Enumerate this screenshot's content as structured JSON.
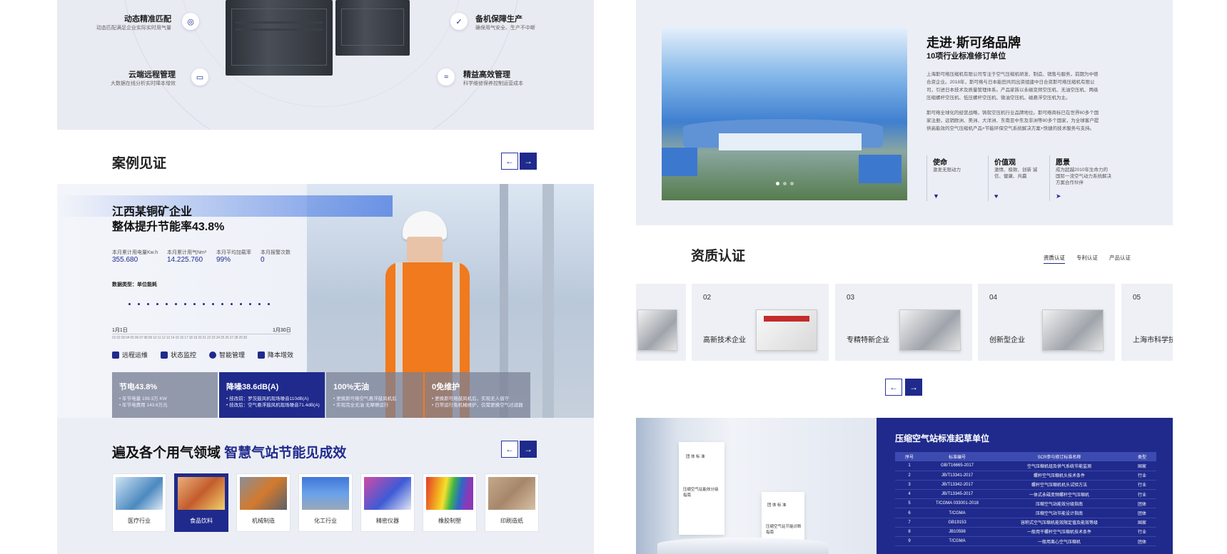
{
  "hero": {
    "features": [
      {
        "title": "动态精准匹配",
        "sub": "动态匹配满足企业实际实时用气量",
        "icon": "target-icon"
      },
      {
        "title": "云端远程管理",
        "sub": "大数据在线分析实时降本增效",
        "icon": "monitor-icon"
      },
      {
        "title": "备机保障生产",
        "sub": "确保用气安全、生产不中断",
        "icon": "shield-check-icon"
      },
      {
        "title": "精益高效管理",
        "sub": "科学维修保养控制运营成本",
        "icon": "chart-icon"
      }
    ]
  },
  "cases": {
    "title": "案例见证",
    "headline_1": "江西某铜矿企业",
    "headline_2": "整体提升节能率43.8%",
    "stats": [
      {
        "label": "本月累计用电量Kw.h",
        "value": "355.680"
      },
      {
        "label": "本月累计用气Nm³",
        "value": "14.225.760"
      },
      {
        "label": "本月平均加载率",
        "value": "99%"
      },
      {
        "label": "本月报警次数",
        "value": "0"
      }
    ],
    "data_type": "数据类型：单位能耗",
    "range_start": "1月1日",
    "range_end": "1月30日",
    "days": "01 02 03 04 05 06 07 08 09 10 11 12 13 14 15 16 17 18 19 20 21 22 23 24 25 26 27 28 29 30",
    "tags": [
      "远程运维",
      "状态监控",
      "智能管理",
      "降本增效"
    ],
    "cards": [
      {
        "title": "节电43.8%",
        "lines": [
          "• 年节电量 199.3万 KW",
          "• 年节电费用 143.6万元"
        ]
      },
      {
        "title": "降噪38.6dB(A)",
        "lines": [
          "• 技改前：罗茨鼓风机现场噪音110dB(A)",
          "• 技改后：空气悬浮鼓风机现场噪音71.4dB(A)"
        ]
      },
      {
        "title": "100%无油",
        "lines": [
          "• 更换斯可络空气悬浮鼓风机后",
          "• 实现完全无油 无摩擦运行"
        ]
      },
      {
        "title": "0免维护",
        "lines": [
          "• 更换斯可络鼓风机后，实现无人值守",
          "• 日常运行免机械维护，仅需更换空气过滤器"
        ]
      }
    ]
  },
  "industries": {
    "title_a": "遍及各个用气领域",
    "title_b": "智慧气站节能见成效",
    "items": [
      "医疗行业",
      "食品饮料",
      "机械制造",
      "化工行业",
      "精密仪器",
      "橡胶制塑",
      "印刷造纸"
    ]
  },
  "brand": {
    "title": "走进·斯可络品牌",
    "subtitle": "10项行业标准修订单位",
    "para1": "上海斯可络压缩机有限公司专注于空气压缩机研发、制造、销售与服务，前期为中德合资企业。2018年，斯可络与日本能田共同出资组建中日合资斯可络压缩机有限公司，引进日本技术及质量管理体系。产品家族以永磁变频空压机、无油空压机、两级压缩螺杆空压机、低压螺杆空压机、微油空压机、磁悬浮空压机为主。",
    "para2": "斯可络全球化的经营战略，铸就空压机行业品牌地位。斯可络商标已在世界60多个国家注册，远销欧洲、美洲、大洋洲、东南亚中东及非洲等80多个国家，为全球客户提供高能效的空气压缩机产品+节能环保空气系统解决方案+快捷的技术服务与支持。",
    "values": [
      {
        "title": "使命",
        "desc": "激发无限动力",
        "icon": "trophy-icon"
      },
      {
        "title": "价值观",
        "desc": "激情、极致、创新 诚信、健康、共赢",
        "icon": "heart-icon"
      },
      {
        "title": "愿景",
        "desc": "成为超越2010年生命力的国际一流空气动力系统解决方案合作伙伴",
        "icon": "send-icon"
      }
    ]
  },
  "certs": {
    "title": "资质认证",
    "tabs": [
      "资质认证",
      "专利认证",
      "产品认证"
    ],
    "items": [
      {
        "num": "02",
        "name": "高新技术企业",
        "style": "red"
      },
      {
        "num": "03",
        "name": "专精特新企业",
        "style": "silver"
      },
      {
        "num": "04",
        "name": "创新型企业",
        "style": "silver"
      },
      {
        "num": "05",
        "name": "上海市科学技",
        "style": "plain"
      }
    ]
  },
  "standards": {
    "title": "压缩空气站标准起草单位",
    "doc1_head": "团 体 标 准",
    "doc1_title": "压缩空气站能效分级指南",
    "doc2_head": "团 体 标 准",
    "doc2_title": "压缩空气站节能诊断指南",
    "headers": [
      "序号",
      "标准编号",
      "SCR参与修订标准名称",
      "类型"
    ],
    "rows": [
      [
        "1",
        "GB/T16665-2017",
        "空气压缩机组及供气系统节能监测",
        "国家"
      ],
      [
        "2",
        "JB/T13341-2017",
        "螺杆空气压缩机头技术条件",
        "行业"
      ],
      [
        "3",
        "JB/T13342-2017",
        "螺杆空气压缩机机头试验方法",
        "行业"
      ],
      [
        "4",
        "JB/T13345-2017",
        "一体式永磁变频螺杆空气压缩机",
        "行业"
      ],
      [
        "5",
        "T/CGMA 033001-2018",
        "压缩空气站能效分级指南",
        "团体"
      ],
      [
        "6",
        "T/CGMA",
        "压缩空气站节能设计指南",
        "团体"
      ],
      [
        "7",
        "GB19153",
        "容积式空气压缩机能效限定值及能效等级",
        "国家"
      ],
      [
        "8",
        "JB10598",
        "一般用干螺杆空气压缩机技术条件",
        "行业"
      ],
      [
        "9",
        "T/CGMA",
        "一般用离心空气压缩机",
        "团体"
      ]
    ]
  }
}
